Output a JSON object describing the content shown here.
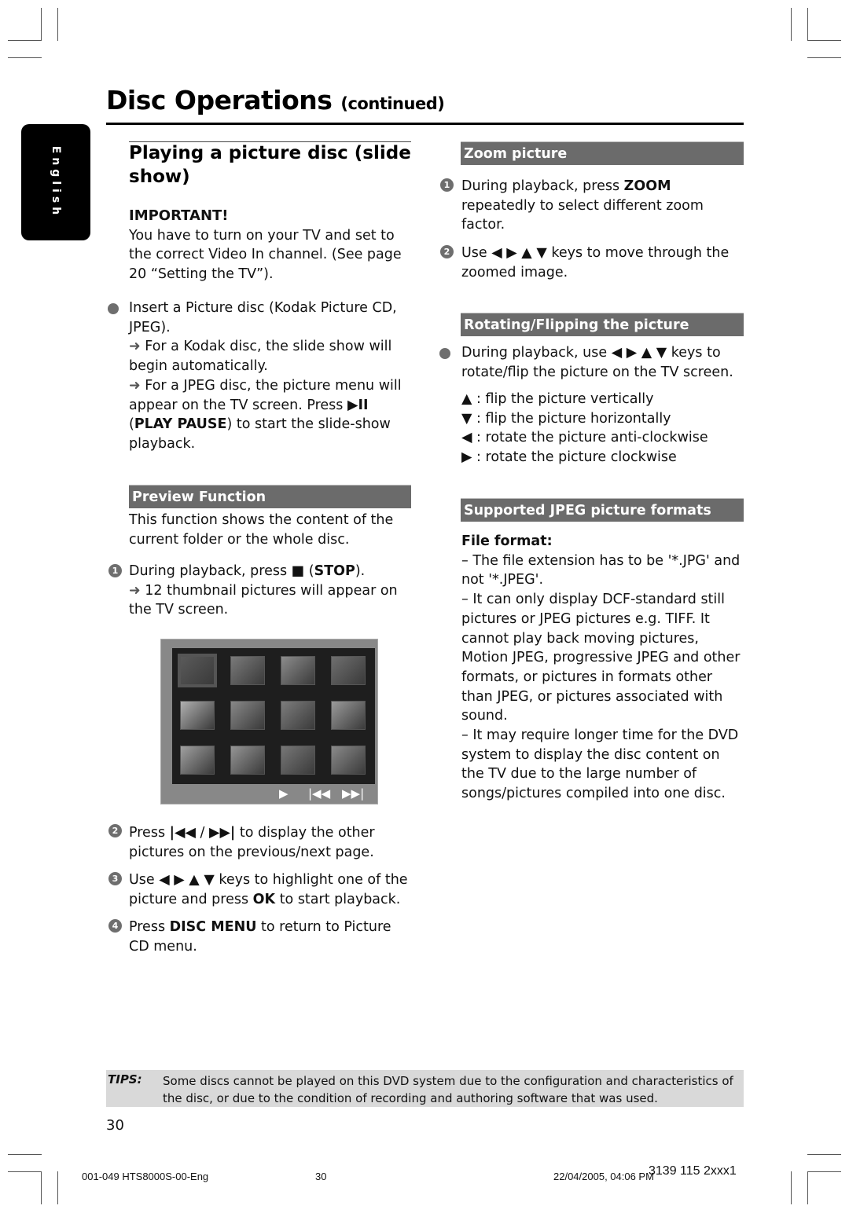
{
  "header": {
    "title": "Disc Operations",
    "title_suffix": "(continued)"
  },
  "language_tab": "English",
  "left": {
    "section_title": "Playing a picture disc (slide show)",
    "important_label": "IMPORTANT!",
    "important_text": "You have to turn on your TV and set to the correct Video In channel.  (See page 20 “Setting the TV”).",
    "bullet_insert": "Insert a Picture disc (Kodak Picture CD, JPEG).",
    "result_kodak": "For a Kodak disc, the slide show will begin automatically.",
    "result_jpeg_pre": "For a JPEG disc, the picture menu will appear on the TV screen.  Press",
    "play_pause_icon": "▶II",
    "play_pause_label": "PLAY PAUSE",
    "result_jpeg_post": "to start the slide-show playback.",
    "preview": {
      "heading": "Preview Function",
      "intro": "This function shows the content of the current folder or the whole disc.",
      "step1_pre": "During playback, press",
      "stop_icon": "■",
      "stop_label": "STOP",
      "step1_result": "12 thumbnail pictures will appear on the TV screen.",
      "screen_controls": {
        "play": "▶",
        "prev": "|◀◀",
        "next": "▶▶|"
      },
      "thumbnail_count": 12,
      "step2_pre": "Press",
      "prev_icon": "|◀◀",
      "next_icon": "▶▶|",
      "step2_post": "to display the other pictures on the previous/next page.",
      "step3_pre": "Use ◀ ▶ ▲ ▼ keys to highlight one of the picture and press",
      "ok_label": "OK",
      "step3_post": "to start playback.",
      "step4_pre": "Press",
      "disc_menu_label": "DISC MENU",
      "step4_post": "to return to Picture CD menu."
    }
  },
  "right": {
    "zoom": {
      "heading": "Zoom picture",
      "step1_pre": "During playback, press",
      "zoom_label": "ZOOM",
      "step1_post": "repeatedly to select different zoom factor.",
      "step2": "Use ◀ ▶ ▲ ▼ keys to move through the zoomed image."
    },
    "rotate": {
      "heading": "Rotating/Flipping the picture",
      "bullet": "During playback, use ◀ ▶ ▲ ▼ keys to rotate/flip the picture on the TV screen.",
      "items": [
        {
          "icon": "▲",
          "text": ": flip the picture vertically"
        },
        {
          "icon": "▼",
          "text": ": flip the picture horizontally"
        },
        {
          "icon": "◀",
          "text": ": rotate the picture anti-clockwise"
        },
        {
          "icon": "▶",
          "text": ": rotate the picture clockwise"
        }
      ]
    },
    "formats": {
      "heading": "Supported JPEG picture formats",
      "file_format_label": "File format:",
      "items": [
        "–  The file extension has to be '*.JPG' and not '*.JPEG'.",
        "–  It can only display DCF-standard still pictures or JPEG pictures e.g. TIFF.  It cannot play back moving pictures, Motion JPEG, progressive JPEG and other formats, or pictures in formats other than JPEG, or pictures associated with sound.",
        "–  It may require longer time for the DVD system to display the disc content on the TV due to the large number of songs/pictures compiled into one disc."
      ]
    }
  },
  "tips": {
    "label": "TIPS:",
    "text": "Some discs cannot be played on this DVD system due to the configuration and characteristics of the disc, or due to the condition of recording and authoring software that was used."
  },
  "page_number": "30",
  "footer": {
    "file": "001-049 HTS8000S-00-Eng",
    "page": "30",
    "timestamp": "22/04/2005, 04:06 PM",
    "code": "3139 115 2xxx1"
  }
}
